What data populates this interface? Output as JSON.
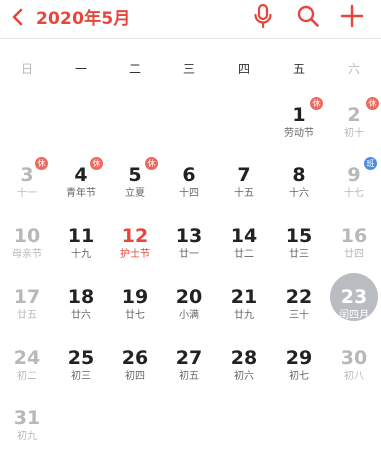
{
  "header": {
    "title": "2020年5月",
    "back_icon": "chevron-left-icon",
    "mic_icon": "microphone-icon",
    "search_icon": "search-icon",
    "add_icon": "plus-icon",
    "accent_color": "#e8453c"
  },
  "weekdays": [
    "日",
    "一",
    "二",
    "三",
    "四",
    "五",
    "六"
  ],
  "badges": {
    "holiday": "休",
    "work": "班"
  },
  "days": [
    {
      "day": "1",
      "sub": "劳动节",
      "badge": "休"
    },
    {
      "day": "2",
      "sub": "初十",
      "badge": "休"
    },
    {
      "day": "3",
      "sub": "十一",
      "badge": "休"
    },
    {
      "day": "4",
      "sub": "青年节",
      "badge": "休"
    },
    {
      "day": "5",
      "sub": "立夏",
      "badge": "休"
    },
    {
      "day": "6",
      "sub": "十四"
    },
    {
      "day": "7",
      "sub": "十五"
    },
    {
      "day": "8",
      "sub": "十六"
    },
    {
      "day": "9",
      "sub": "十七",
      "badge": "班"
    },
    {
      "day": "10",
      "sub": "母亲节"
    },
    {
      "day": "11",
      "sub": "十九"
    },
    {
      "day": "12",
      "sub": "护士节"
    },
    {
      "day": "13",
      "sub": "廿一"
    },
    {
      "day": "14",
      "sub": "廿二"
    },
    {
      "day": "15",
      "sub": "廿三"
    },
    {
      "day": "16",
      "sub": "廿四"
    },
    {
      "day": "17",
      "sub": "廿五"
    },
    {
      "day": "18",
      "sub": "廿六"
    },
    {
      "day": "19",
      "sub": "廿七"
    },
    {
      "day": "20",
      "sub": "小满"
    },
    {
      "day": "21",
      "sub": "廿九"
    },
    {
      "day": "22",
      "sub": "三十"
    },
    {
      "day": "23",
      "sub": "闰四月"
    },
    {
      "day": "24",
      "sub": "初二"
    },
    {
      "day": "25",
      "sub": "初三"
    },
    {
      "day": "26",
      "sub": "初四"
    },
    {
      "day": "27",
      "sub": "初五"
    },
    {
      "day": "28",
      "sub": "初六"
    },
    {
      "day": "29",
      "sub": "初七"
    },
    {
      "day": "30",
      "sub": "初八"
    },
    {
      "day": "31",
      "sub": "初九"
    }
  ]
}
